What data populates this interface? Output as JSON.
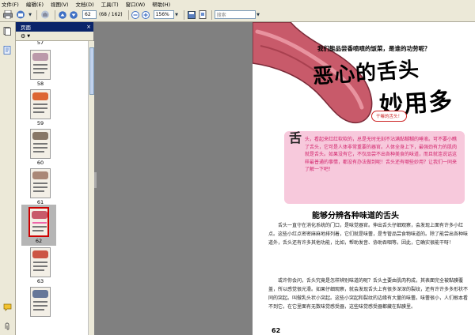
{
  "menu": [
    "文件(F)",
    "编辑(E)",
    "视图(V)",
    "文档(D)",
    "工具(T)",
    "窗口(W)",
    "帮助(H)"
  ],
  "toolbar": {
    "page_current": "62",
    "page_total": "(68 / 162)",
    "zoom": "156%",
    "search_placeholder": "搜索"
  },
  "panel": {
    "title": "页面",
    "close": "×"
  },
  "thumbnails": [
    {
      "label": "57"
    },
    {
      "label": "58"
    },
    {
      "label": "59"
    },
    {
      "label": "60"
    },
    {
      "label": "61"
    },
    {
      "label": "62"
    },
    {
      "label": "63"
    }
  ],
  "page": {
    "subtitle": "我们能品尝香喷喷的饭菜，是谁的功劳呢？",
    "title_line1": "恶心的舌头",
    "title_line2": "妙用多",
    "bubble": "干嘛的舌头！",
    "intro_char": "舌",
    "intro_text": "头，看起来红红软软的，总是无时无刻不沾满黏糊糊的唾液。可不要小瞧了舌头，它可是人体非常重要的器官。人体全身上下，最强劲有力的肌肉就是舌头。如果没有它，不仅品尝不出各种美食的味道，而且就连说话这样最普通的事情，都没有办法做到呢！舌头还有哪些妙用？让我们一同来了解一下吧！",
    "section_title": "能够分辨各种味道的舌头",
    "para1": "舌头一直守在消化系统的门口，是味觉器官。伸出舌头仔细观察，会发现上面有许多小红点。这些小红点密密麻麻地排列着，它们就是味蕾，是专管品尝食物味道的。除了能尝出各种味道外，舌头还有许多其他功能，比如，帮助发音、协助吞咽等。因此，它确实很能干呀！",
    "para2": "或许你会问，舌头究竟是怎样辨别味道的呢？舌头主要由肌肉构成，其表面完全被黏膜覆盖，所以感觉很光滑。如果仔细观察，就会发现舌头上有很多深深的裂纹，还有许许多多形状不同的突起。叫做乳头状小突起。这些小突起和裂纹的边缘有大量的味蕾。味蕾很小，人们根本看不到它，在它里面有无数味觉感受器，这些味觉感受器都藏在黏膜里。",
    "page_number": "62"
  },
  "colors": {
    "selection_bar": "#0a246a",
    "intro_bg": "#f7c9dc",
    "intro_text": "#d2236b",
    "tongue": "#c85a6a",
    "gray_workspace": "#808080"
  }
}
